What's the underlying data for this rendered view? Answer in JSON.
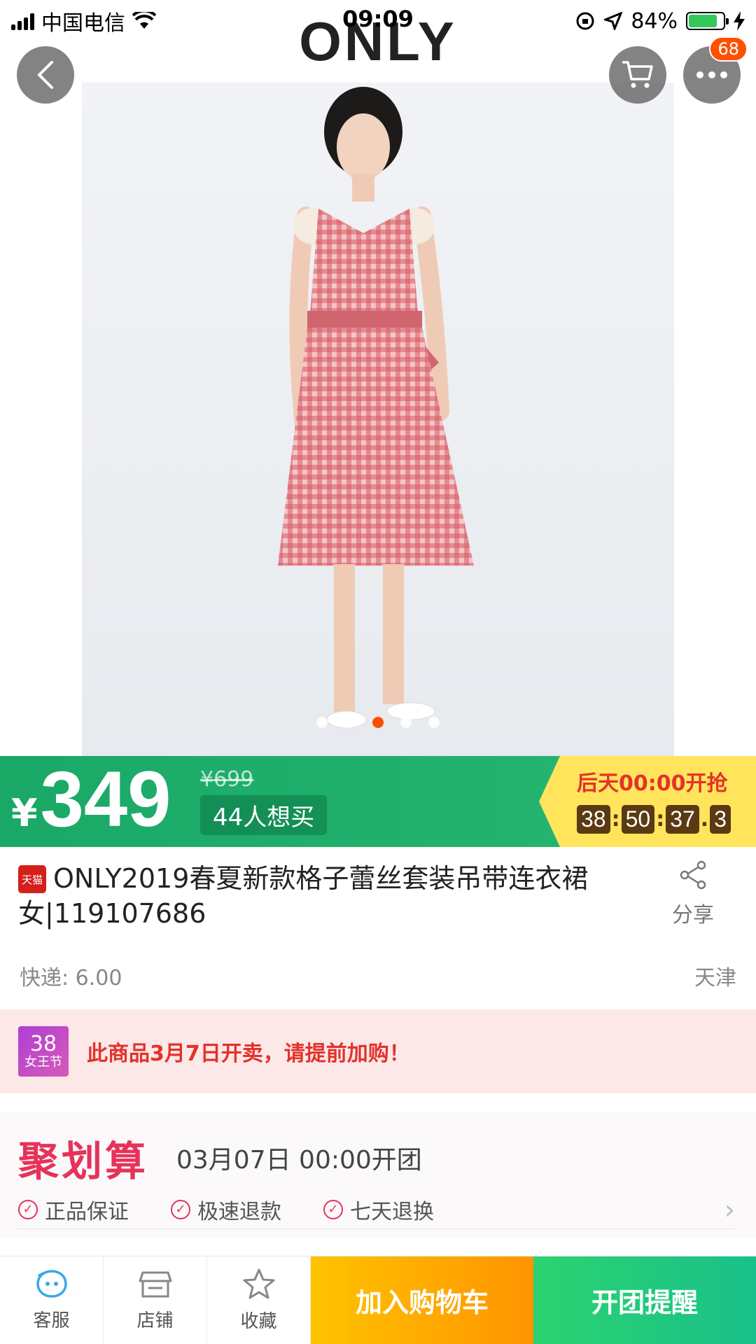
{
  "status_bar": {
    "carrier": "中国电信",
    "time": "09:09",
    "battery": "84%",
    "battery_level": 0.84
  },
  "header": {
    "brand": "ONLY",
    "more_badge": "68"
  },
  "carousel": {
    "slide_count": 5,
    "active_index": 2
  },
  "price": {
    "currency": "¥",
    "current": "349",
    "original": "¥699",
    "want_count": "44人想买"
  },
  "countdown": {
    "title": "后天00:00开抢",
    "hours": "38",
    "minutes": "50",
    "seconds": "37",
    "tenths": "3"
  },
  "product": {
    "tmall_label": "天猫",
    "title": "ONLY2019春夏新款格子蕾丝套装吊带连衣裙女|119107686",
    "share_label": "分享"
  },
  "shipping": {
    "fee": "快递: 6.00",
    "location": "天津"
  },
  "promo": {
    "badge_top": "38",
    "badge_bottom": "女王节",
    "text": "此商品3月7日开卖，请提前加购！"
  },
  "juhuasuan": {
    "logo": "聚划算",
    "date": "03月07日 00:00开团",
    "guarantees": [
      "正品保证",
      "极速退款",
      "七天退换"
    ]
  },
  "bottom_bar": {
    "service": "客服",
    "store": "店铺",
    "favorite": "收藏",
    "add_to_cart": "加入购物车",
    "remind": "开团提醒"
  },
  "colors": {
    "price_green": "#1aa866",
    "countdown_yellow": "#ffe45c",
    "accent_red": "#e3322b",
    "juhuasuan_pink": "#e5335a",
    "cart_orange": "#ff9400",
    "remind_green": "#2bd36f"
  }
}
